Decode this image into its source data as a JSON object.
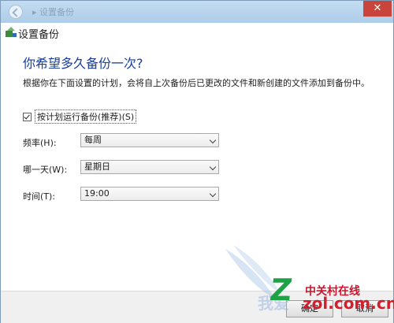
{
  "window": {
    "breadcrumb_blur": "▸ 设置备份",
    "title": "设置备份",
    "close_glyph": "✕"
  },
  "page": {
    "heading": "你希望多久备份一次?",
    "description": "根据你在下面设置的计划，会将自上次备份后已更改的文件和新创建的文件添加到备份中。"
  },
  "schedule_checkbox": {
    "checked": true,
    "label": "按计划运行备份(推荐)(S)"
  },
  "fields": [
    {
      "label": "频率(H):",
      "value": "每周"
    },
    {
      "label": "哪一天(W):",
      "value": "星期日"
    },
    {
      "label": "时间(T):",
      "value": "19:00"
    }
  ],
  "buttons": {
    "ok": "确定",
    "cancel": "取消"
  },
  "watermark": {
    "brand": "中关村在线",
    "url": "zol.com.cn",
    "left_text": "我爱"
  },
  "colors": {
    "heading": "#1a3e9a",
    "titlebar": "#b9d6ee",
    "close": "#c9443b",
    "watermark_green": "#1fa145",
    "watermark_red": "#d41e2c"
  },
  "icons": {
    "back": "back-arrow-icon",
    "header": "backup-icon",
    "dropdown": "chevron-down-icon",
    "check": "checkmark-icon"
  }
}
